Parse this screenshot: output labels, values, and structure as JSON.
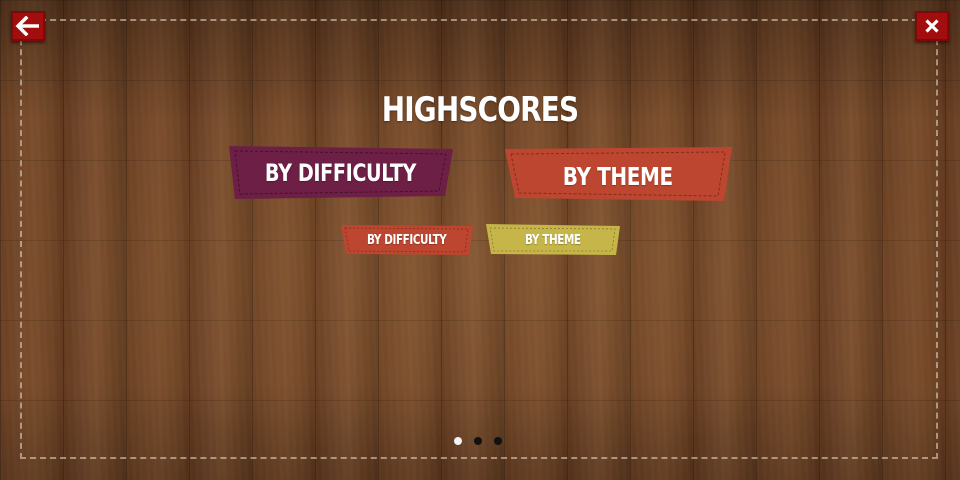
{
  "screen": {
    "title": "HIGHSCORES"
  },
  "buttons": {
    "back_icon": "arrow-left-icon",
    "close_icon": "close-x-icon",
    "accent_color": "#a20d0d"
  },
  "tabs_primary": [
    {
      "label": "BY DIFFICULTY",
      "color": "#6d1f45"
    },
    {
      "label": "BY THEME",
      "color": "#bd4630"
    }
  ],
  "tabs_secondary": [
    {
      "label": "BY DIFFICULTY",
      "color": "#bd4630"
    },
    {
      "label": "BY THEME",
      "color": "#c6b548"
    }
  ],
  "pagination": {
    "count": 3,
    "active_index": 0
  }
}
